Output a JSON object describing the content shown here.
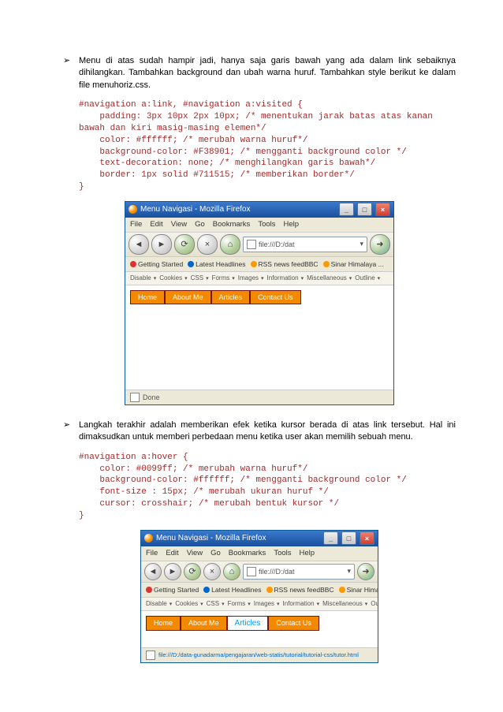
{
  "bullets": {
    "p1": "Menu di atas sudah hampir jadi, hanya saja garis bawah yang ada dalam link sebaiknya dihilangkan. Tambahkan background dan ubah warna huruf. Tambahkan style berikut ke dalam file menuhoriz.css.",
    "p2": "Langkah terakhir adalah memberikan efek ketika kursor berada di atas link tersebut. Hal ini dimaksudkan untuk memberi perbedaan menu ketika user akan memilih sebuah menu."
  },
  "code1": "#navigation a:link, #navigation a:visited {\n    padding: 3px 10px 2px 10px; /* menentukan jarak batas atas kanan\nbawah dan kiri masig-masing elemen*/\n    color: #ffffff; /* merubah warna huruf*/\n    background-color: #F38901; /* mengganti background color */\n    text-decoration: none; /* menghilangkan garis bawah*/\n    border: 1px solid #711515; /* memberikan border*/\n}",
  "code2": "#navigation a:hover {\n    color: #0099ff; /* merubah warna huruf*/\n    background-color: #ffffff; /* mengganti background color */\n    font-size : 15px; /* merubah ukuran huruf */\n    cursor: crosshair; /* merubah bentuk kursor */\n}",
  "browser": {
    "title": "Menu Navigasi - Mozilla Firefox",
    "menus": {
      "file": "File",
      "edit": "Edit",
      "view": "View",
      "go": "Go",
      "bookmarks": "Bookmarks",
      "tools": "Tools",
      "help": "Help"
    },
    "url": "file:///D:/dat",
    "url2": "file:///D:/dat",
    "bookmarks": [
      "Getting Started",
      "Latest Headlines",
      "RSS news feedBBC",
      "Sinar Himalaya ..."
    ],
    "devtools": [
      "Disable",
      "Cookies",
      "CSS",
      "Forms",
      "Images",
      "Information",
      "Miscellaneous",
      "Outline"
    ],
    "nav_items": [
      "Home",
      "About Me",
      "Articles",
      "Contact Us"
    ],
    "status_done": "Done",
    "status_url": "file:///D:/data-gunadarma/pengajaran/web-statis/tutorial/tutorial-css/tutor.html"
  }
}
